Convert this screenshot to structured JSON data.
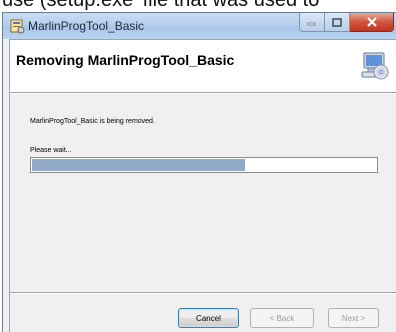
{
  "background_caption": "use (setup.exe' file that was used to",
  "window": {
    "title": "MarlinProgTool_Basic",
    "caption_buttons": {
      "minimize_icon": "minimize-icon",
      "maximize_icon": "maximize-icon",
      "close_icon": "close-icon"
    }
  },
  "header": {
    "title": "Removing MarlinProgTool_Basic",
    "icon": "computer-cd-icon"
  },
  "body": {
    "status_message": "MarlinProgTool_Basic is being removed.",
    "progress_label": "Please wait...",
    "progress_fraction": 0.62
  },
  "buttons": {
    "cancel": "Cancel",
    "back": "< Back",
    "next": "Next >"
  },
  "colors": {
    "progress_fill": "#91aac8",
    "close_button": "#c2341f"
  }
}
